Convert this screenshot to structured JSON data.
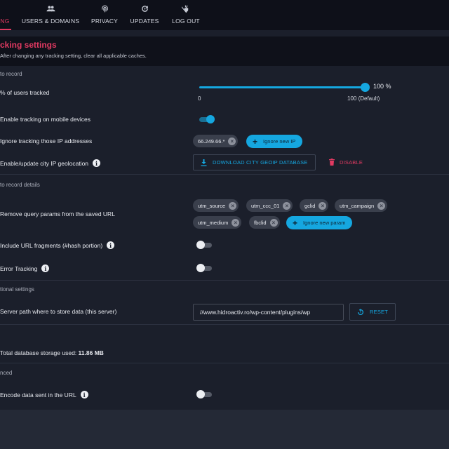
{
  "nav": {
    "items": [
      {
        "label": "NG",
        "icon": "gauge-icon",
        "active": true
      },
      {
        "label": "USERS & DOMAINS",
        "icon": "users-icon"
      },
      {
        "label": "PRIVACY",
        "icon": "fingerprint-icon"
      },
      {
        "label": "UPDATES",
        "icon": "refresh-icon"
      },
      {
        "label": "LOG OUT",
        "icon": "logout-icon"
      }
    ]
  },
  "header": {
    "title": "cking settings",
    "subtitle": "After changing any tracking setting, clear all applicable caches."
  },
  "sections": {
    "to_record": "to record",
    "record_details": "to record details",
    "additional": "tional settings",
    "advanced": "nced"
  },
  "users_tracked": {
    "label": "% of users tracked",
    "value": "100 %",
    "percent": 100,
    "min_label": "0",
    "max_label": "100 (Default)"
  },
  "mobile_tracking": {
    "label": "Enable tracking on mobile devices",
    "enabled": true
  },
  "ignore_ips": {
    "label": "Ignore tracking those IP addresses",
    "chips": [
      "66.249.66.*"
    ],
    "add_label": "Ignore new IP"
  },
  "geolocation": {
    "label": "Enable/update city IP geolocation",
    "download_label": "DOWNLOAD CITY GEOIP DATABASE",
    "disable_label": "DISABLE"
  },
  "query_params": {
    "label": "Remove query params from the saved URL",
    "chips": [
      "utm_source",
      "utm_ccc_01",
      "gclid",
      "utm_campaign",
      "utm_medium",
      "fbclid"
    ],
    "add_label": "Ignore new param"
  },
  "url_fragments": {
    "label": "Include URL fragments (#hash portion)",
    "enabled": false
  },
  "error_tracking": {
    "label": "Error Tracking",
    "enabled": false
  },
  "server_path": {
    "label": "Server path where to store data (this server)",
    "value": "//www.hidroactiv.ro/wp-content/plugins/wp",
    "reset_label": "RESET"
  },
  "storage": {
    "label": "Total database storage used:",
    "value": "11.86 MB"
  },
  "encode": {
    "label": "Encode data sent in the URL",
    "enabled": false
  },
  "colors": {
    "accent": "#e23a62",
    "primary": "#15a7e0",
    "background": "#1b1f2b"
  }
}
